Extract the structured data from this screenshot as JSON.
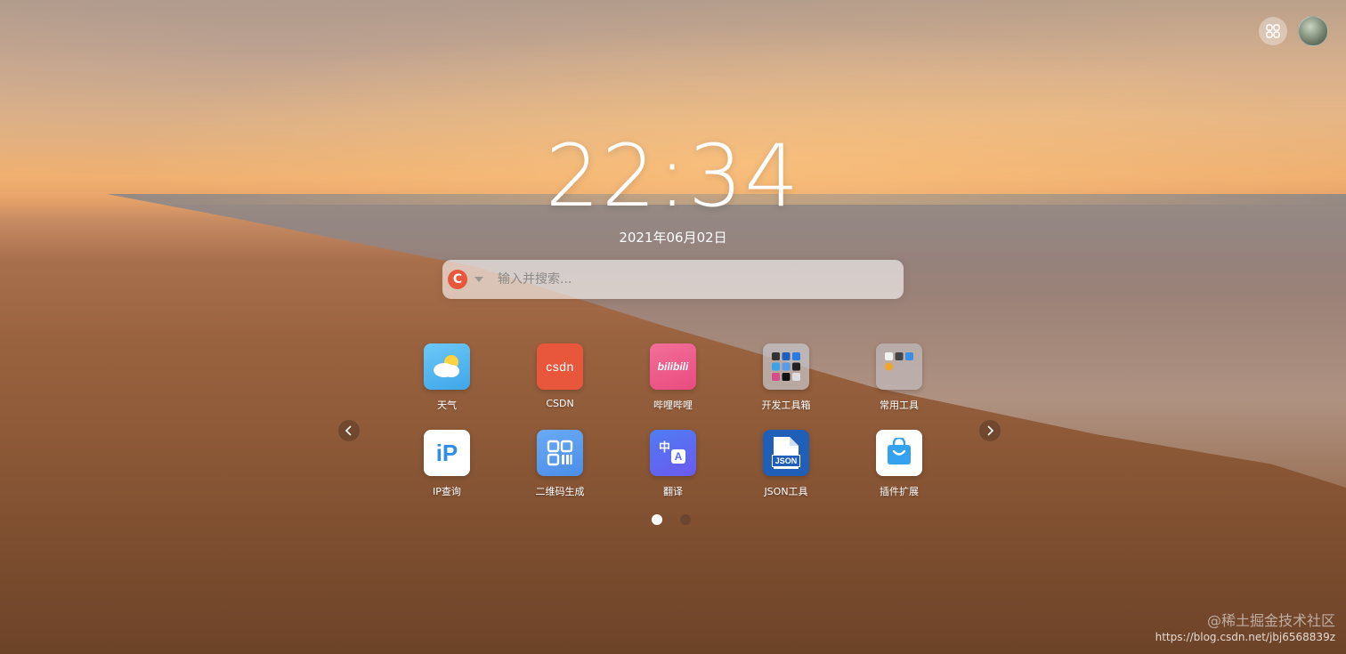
{
  "clock": {
    "time": "22:34",
    "date": "2021年06月02日"
  },
  "search": {
    "engine_letter": "C",
    "placeholder": "输入并搜索..."
  },
  "apps": [
    {
      "label": "天气",
      "icon": "weather-icon"
    },
    {
      "label": "CSDN",
      "icon": "csdn-icon",
      "icon_text": "CSDN"
    },
    {
      "label": "哔哩哔哩",
      "icon": "bilibili-icon",
      "icon_text": "bilibili"
    },
    {
      "label": "开发工具箱",
      "icon": "dev-toolbox-folder-icon"
    },
    {
      "label": "常用工具",
      "icon": "common-tools-folder-icon"
    },
    {
      "label": "IP查询",
      "icon": "ip-lookup-icon",
      "icon_text": "iP"
    },
    {
      "label": "二维码生成",
      "icon": "qrcode-icon"
    },
    {
      "label": "翻译",
      "icon": "translate-icon",
      "icon_text_a": "中",
      "icon_text_b": "A"
    },
    {
      "label": "JSON工具",
      "icon": "json-tool-icon",
      "icon_text": "JSON"
    },
    {
      "label": "插件扩展",
      "icon": "extension-store-icon"
    }
  ],
  "pagination": {
    "pages": 2,
    "current": 1
  },
  "watermark": {
    "line1": "@稀土掘金技术社区",
    "line2": "https://blog.csdn.net/jbj6568839z"
  },
  "colors": {
    "csdn": "#e8563c",
    "bilibili": "#ee5b8a",
    "weather": "#5ab8f0",
    "qrcode": "#5a9df2",
    "translate": "#5b6bf0",
    "json": "#1f5fb8"
  }
}
